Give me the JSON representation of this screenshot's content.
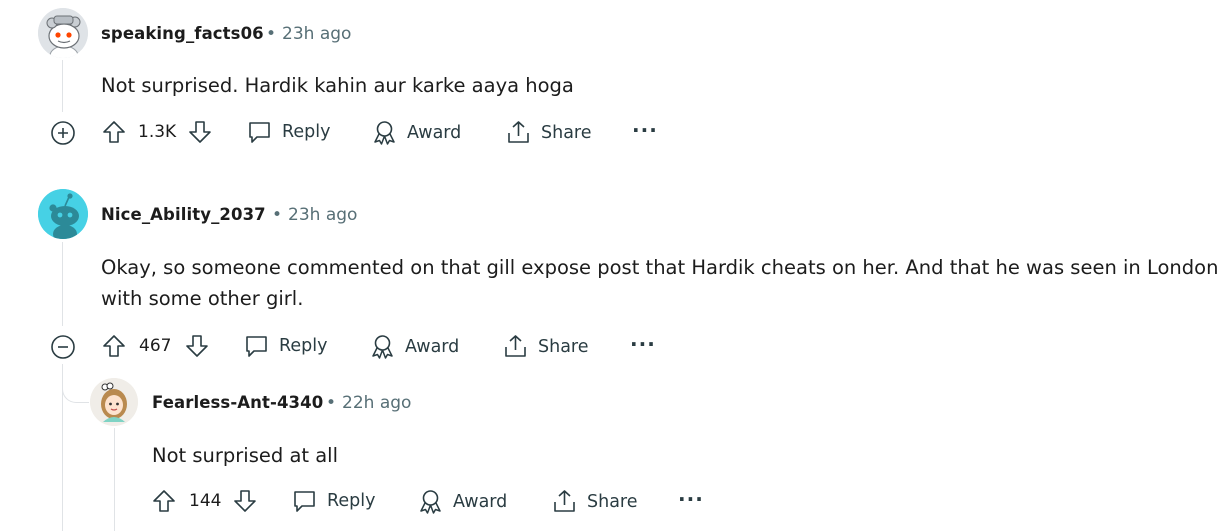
{
  "comments": [
    {
      "username": "speaking_facts06",
      "time": "23h ago",
      "text_lines": [
        "Not surprised. Hardik kahin aur karke aaya hoga"
      ],
      "toggle": "expand",
      "votes": "1.3K",
      "reply_label": "Reply",
      "award_label": "Award",
      "share_label": "Share",
      "more_label": "···"
    },
    {
      "username": "Nice_Ability_2037",
      "time": "23h ago",
      "text_lines": [
        "Okay, so someone commented on that gill expose post that Hardik cheats on her. And that he was seen in London",
        "with some other girl."
      ],
      "toggle": "collapse",
      "votes": "467",
      "reply_label": "Reply",
      "award_label": "Award",
      "share_label": "Share",
      "more_label": "···"
    },
    {
      "username": "Fearless-Ant-4340",
      "time": "22h ago",
      "text_lines": [
        "Not surprised at all"
      ],
      "votes": "144",
      "reply_label": "Reply",
      "award_label": "Award",
      "share_label": "Share",
      "more_label": "···"
    }
  ],
  "separator": "•",
  "colors": {
    "text": "#1c1c1c",
    "meta": "#576f76",
    "thread_line": "#e0e3e6",
    "avatar_teal": "#46d1e5"
  }
}
